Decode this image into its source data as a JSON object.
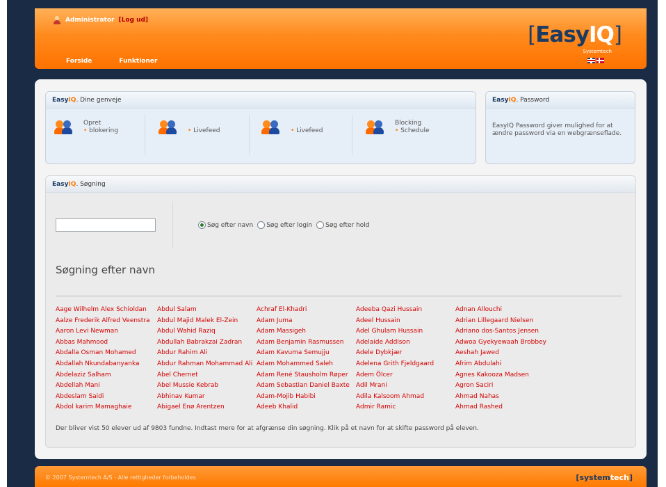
{
  "header": {
    "username": "Administrator",
    "logout": "[Log ud]",
    "nav": [
      "Forside",
      "Funktioner"
    ],
    "logo_main": "Easy",
    "logo_accent": "IQ",
    "logo_sub": "Systemtech",
    "flags": [
      "uk-flag-icon",
      "dk-flag-icon"
    ]
  },
  "shortcuts": {
    "title_brand1": "Easy",
    "title_brand2": "IQ",
    "title": ". Dine genveje",
    "items": [
      {
        "line1": "Opret",
        "line2": "blokering"
      },
      {
        "line1": "",
        "line2": "Livefeed"
      },
      {
        "line1": "",
        "line2": "Livefeed"
      },
      {
        "line1": "Blocking",
        "line2": "Schedule"
      }
    ]
  },
  "password": {
    "title_brand1": "Easy",
    "title_brand2": "IQ",
    "title": ". Password",
    "text": "EasyIQ Password giver mulighed for at ændre password via en webgrænseflade."
  },
  "search": {
    "title_brand1": "Easy",
    "title_brand2": "IQ",
    "title": ". Søgning",
    "input_value": "",
    "radios": [
      "Søg efter navn",
      "Søg efter login",
      "Søg efter hold"
    ],
    "selected_radio": "Søg efter navn",
    "heading": "Søgning efter navn",
    "columns": [
      [
        "Aage Wilhelm Alex Schioldan",
        "Aalze Frederik Alfred Veenstra",
        "Aaron Levi Newman",
        "Abbas Mahmood",
        "Abdalla Osman Mohamed",
        "Abdallah Nkundabanyanka",
        "Abdelaziz Salham",
        "Abdellah Mani",
        "Abdeslam Saidi",
        "Abdol karim Mamaghaie"
      ],
      [
        "Abdul Salam",
        "Abdul Majid Malek El-Zein",
        "Abdul Wahid Raziq",
        "Abdullah Babrakzai Zadran",
        "Abdur Rahim Ali",
        "Abdur Rahman Mohammad Ali",
        "Abel Chernet",
        "Abel Mussie Kebrab",
        "Abhinav Kumar",
        "Abigael Enø Arentzen"
      ],
      [
        "Achraf El-Khadri",
        "Adam Juma",
        "Adam Massigeh",
        "Adam Benjamin Rasmussen",
        "Adam Kavuma Semujju",
        "Adam Mohammed Saleh",
        "Adam René Stausholm Røper",
        "Adam Sebastian Daniel Baxte",
        "Adam-Mojib Habibi",
        "Adeeb Khalid"
      ],
      [
        "Adeeba Qazi Hussain",
        "Adeel Hussain",
        "Adel Ghulam Hussain",
        "Adelaide Addison",
        "Adele Dybkjær",
        "Adelena Grith Fjeldgaard",
        "Adem Ölcer",
        "Adil Mrani",
        "Adila Kalsoom Ahmad",
        "Admir Ramic"
      ],
      [
        "Adnan Allouchi",
        "Adrian Lillegaard Nielsen",
        "Adriano dos-Santos Jensen",
        "Adwoa Gyekyewaah Brobbey",
        "Aeshah Jawed",
        "Afrim Abdulahi",
        "Agnes Kakooza Madsen",
        "Agron Saciri",
        "Ahmad Nahas",
        "Ahmad Rashed"
      ]
    ],
    "note": "Der bliver vist 50 elever ud af 9803 fundne. Indtast mere for at afgrænse din søgning. Klik på et navn for at skifte password på eleven."
  },
  "footer": {
    "copyright": "© 2007 Systemtech A/S - Alle rettigheder forbeholdes",
    "logo_main": "system",
    "logo_accent": "tech"
  },
  "colors": {
    "accent": "#ff7a00",
    "navy": "#1a2b45",
    "link": "#d40000"
  }
}
